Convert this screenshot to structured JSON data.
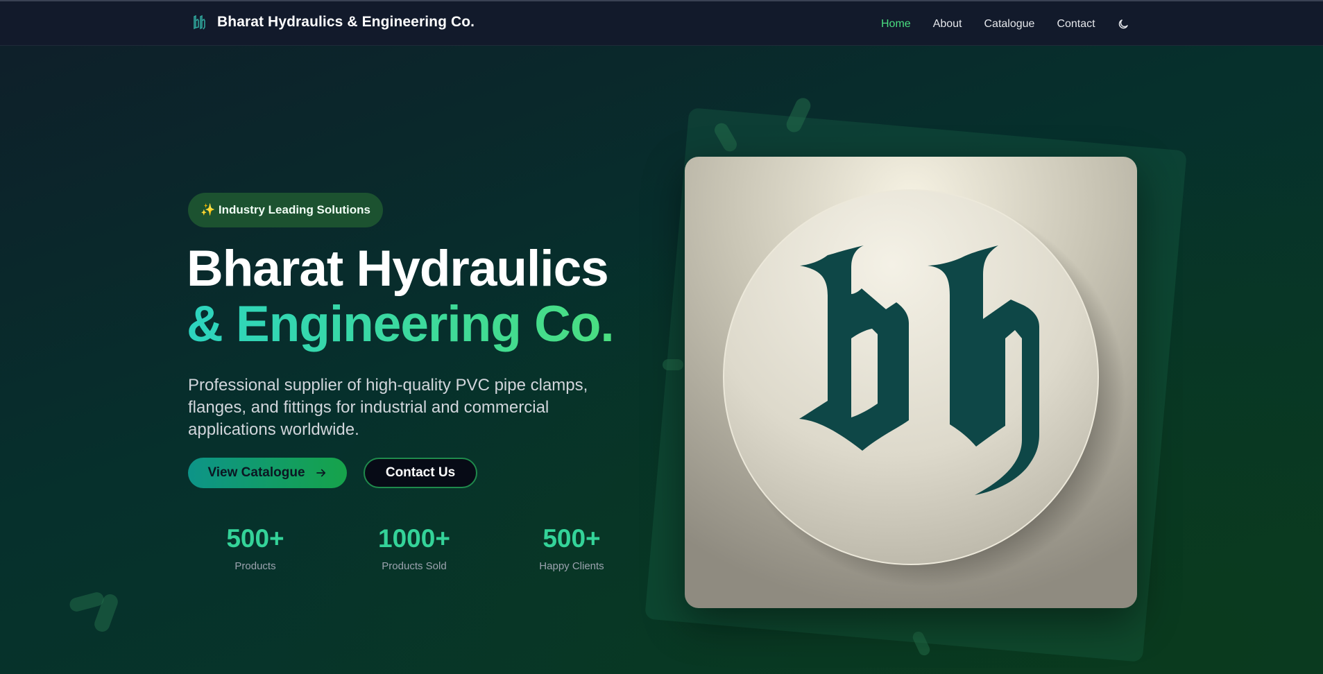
{
  "nav": {
    "brand_icon": "bh-monogram-icon",
    "brand_name": "Bharat Hydraulics & Engineering Co.",
    "links": [
      {
        "label": "Home",
        "active": true
      },
      {
        "label": "About",
        "active": false
      },
      {
        "label": "Catalogue",
        "active": false
      },
      {
        "label": "Contact",
        "active": false
      }
    ],
    "theme_toggle_icon": "moon-icon"
  },
  "hero": {
    "badge": "✨ Industry Leading Solutions",
    "title_line1": "Bharat Hydraulics",
    "title_line2": "& Engineering Co.",
    "description": "Professional supplier of high-quality PVC pipe clamps, flanges, and fittings for industrial and commercial applications worldwide.",
    "primary_button": "View Catalogue",
    "primary_button_icon": "arrow-right-icon",
    "secondary_button": "Contact Us",
    "stats": [
      {
        "value": "500+",
        "label": "Products"
      },
      {
        "value": "1000+",
        "label": "Products Sold"
      },
      {
        "value": "500+",
        "label": "Happy Clients"
      }
    ],
    "image_icon": "bh-logo-medallion"
  },
  "colors": {
    "accent": "#4ade80",
    "teal": "#2dd4bf",
    "nav_bg": "#121a2b",
    "logo_green": "#0e4a4a"
  }
}
